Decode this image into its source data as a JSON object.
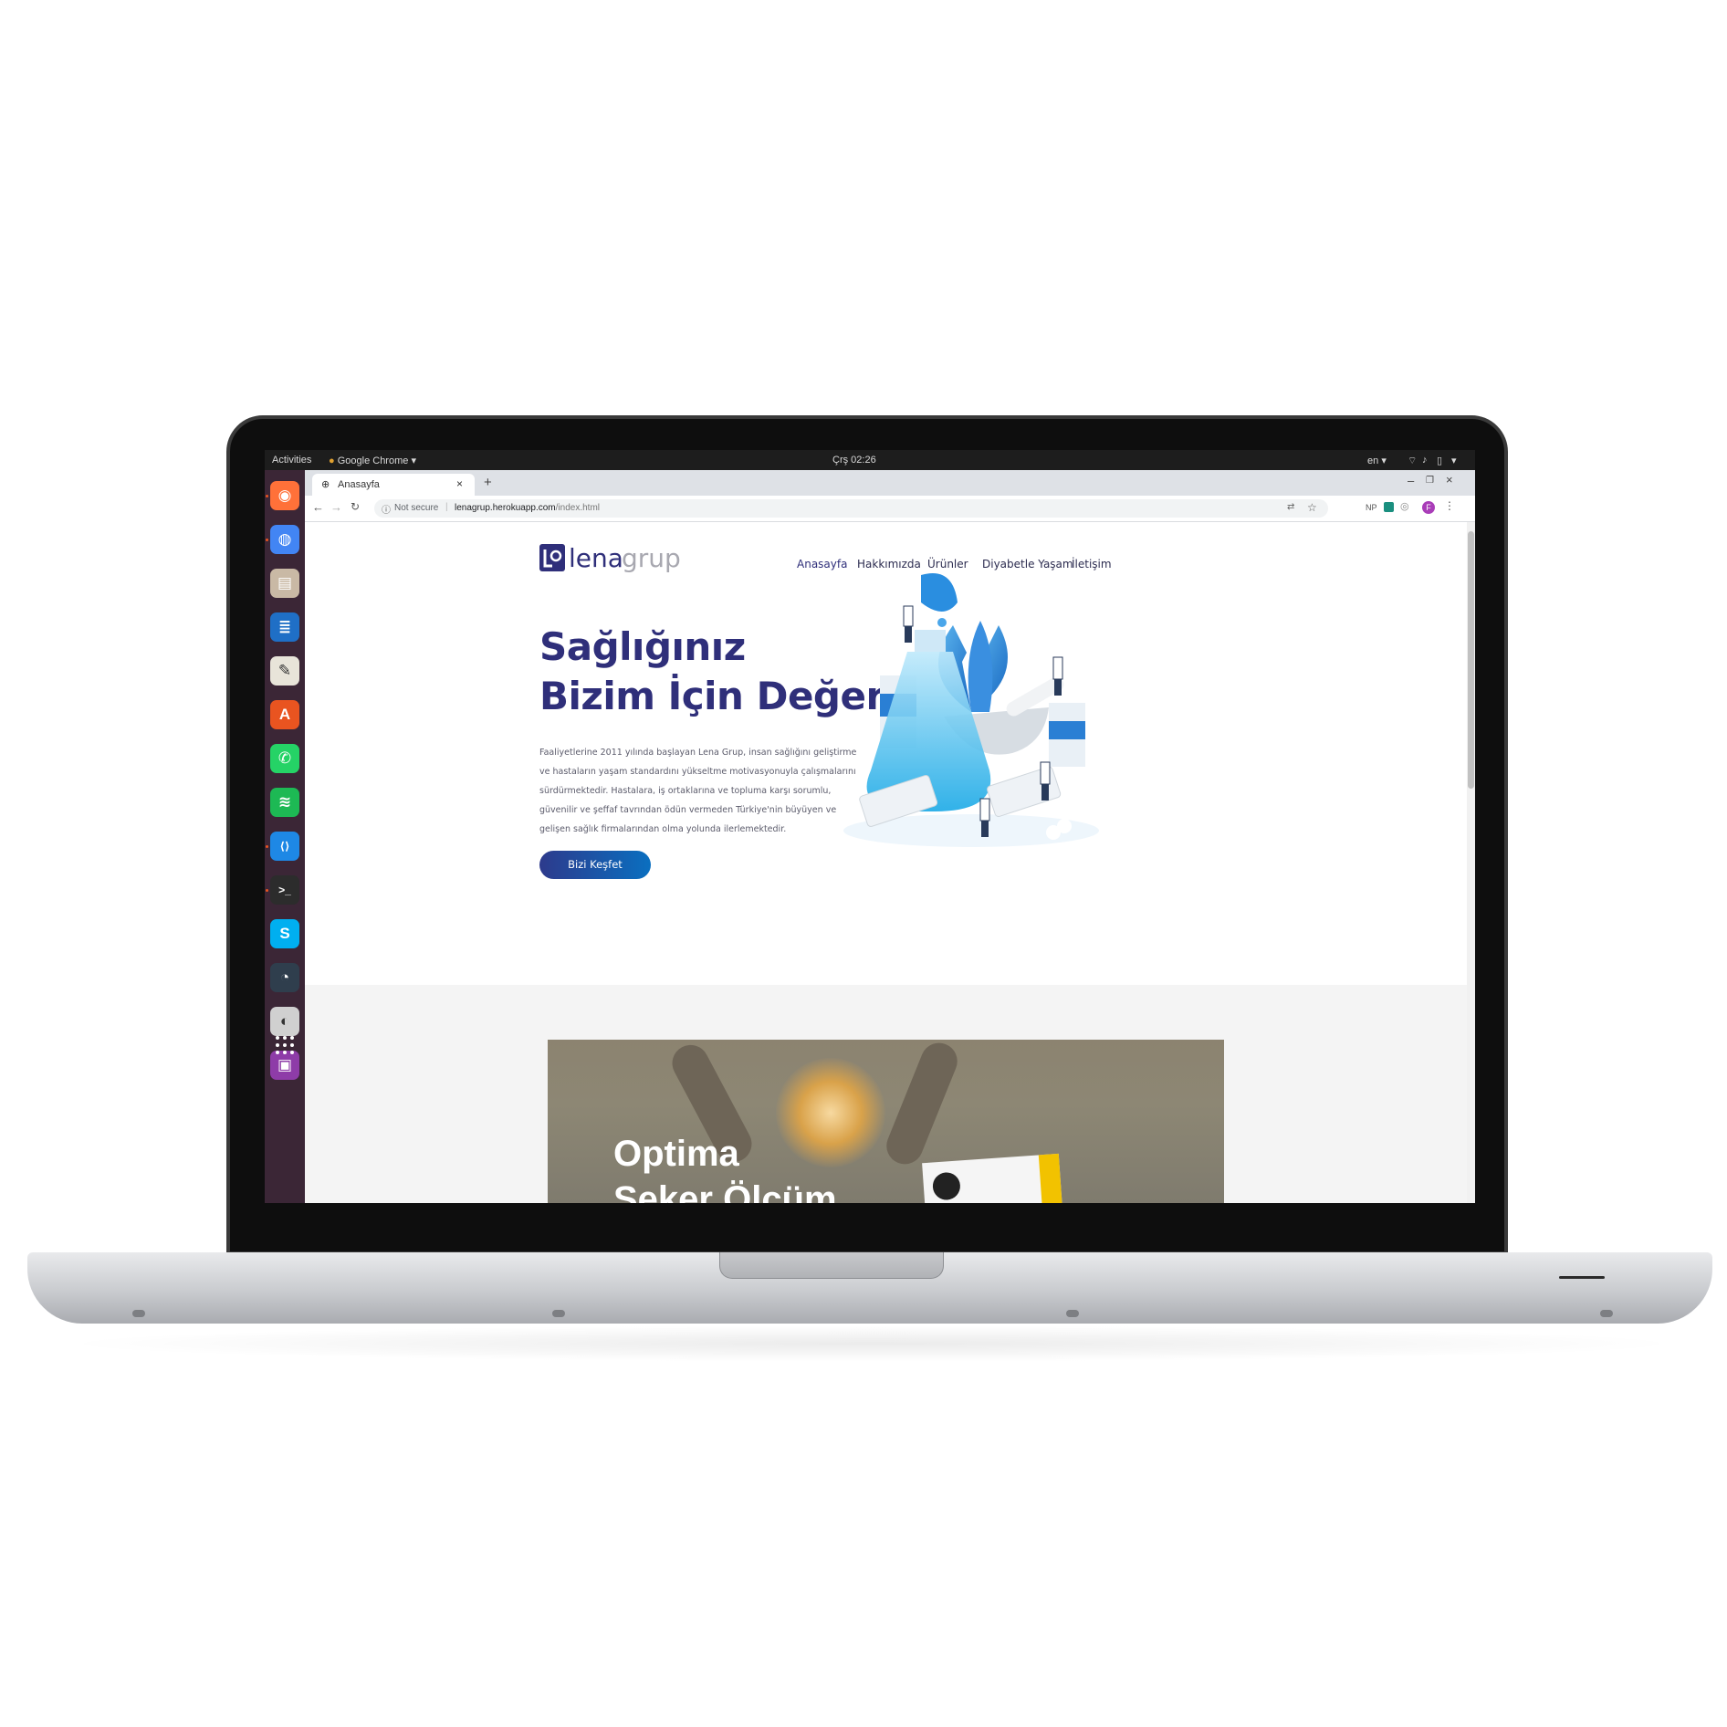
{
  "topbar": {
    "activities": "Activities",
    "app_menu": "Google Chrome",
    "clock": "Çrş 02:26",
    "language": "en"
  },
  "dock": {
    "items": [
      {
        "name": "firefox-icon",
        "color": "#ff7139"
      },
      {
        "name": "chrome-icon",
        "color": "#4285f4"
      },
      {
        "name": "files-icon",
        "color": "#c9b9a5"
      },
      {
        "name": "writer-icon",
        "color": "#1f6fc6"
      },
      {
        "name": "text-editor-icon",
        "color": "#e8e4d9"
      },
      {
        "name": "software-center-icon",
        "color": "#e95420"
      },
      {
        "name": "whatsapp-icon",
        "color": "#25d366"
      },
      {
        "name": "spotify-icon",
        "color": "#1db954"
      },
      {
        "name": "vscode-icon",
        "color": "#1e88e5"
      },
      {
        "name": "terminal-icon",
        "color": "#2c2c2c"
      },
      {
        "name": "skype-icon",
        "color": "#00aff0"
      },
      {
        "name": "disk-usage-icon",
        "color": "#2f3e4d"
      },
      {
        "name": "media-player-icon",
        "color": "#d0d0d0"
      },
      {
        "name": "screen-recorder-icon",
        "color": "#8e3ca8"
      }
    ],
    "show_apps": "show-applications-icon"
  },
  "browser": {
    "tab_title": "Anasayfa",
    "security_label": "Not secure",
    "url_host": "lenagrup.herokuapp.com",
    "url_path": "/index.html",
    "profile_initial": "F",
    "ext_label": "NP"
  },
  "site": {
    "logo_text_primary": "lena",
    "logo_text_secondary": "grup",
    "nav": [
      "Anasayfa",
      "Hakkımızda",
      "Ürünler",
      "Diyabetle Yaşam",
      "İletişim"
    ],
    "hero_title_line1": "Sağlığınız",
    "hero_title_line2": "Bizim İçin Değerli",
    "hero_text": "Faaliyetlerine 2011 yılında başlayan Lena Grup, insan sağlığını geliştirme ve hastaların yaşam standardını yükseltme motivasyonuyla çalışmalarını sürdürmektedir. Hastalara, iş ortaklarına ve topluma karşı sorumlu, güvenilir ve şeffaf tavrından ödün vermeden Türkiye'nin büyüyen ve gelişen sağlık firmalarından olma yolunda ilerlemektedir.",
    "cta": "Bizi Keşfet",
    "banner_line1": "Optima",
    "banner_line2": "Şeker Ölçüm",
    "colors": {
      "primary": "#2f2f7a",
      "accent": "#0a6fc0"
    }
  }
}
